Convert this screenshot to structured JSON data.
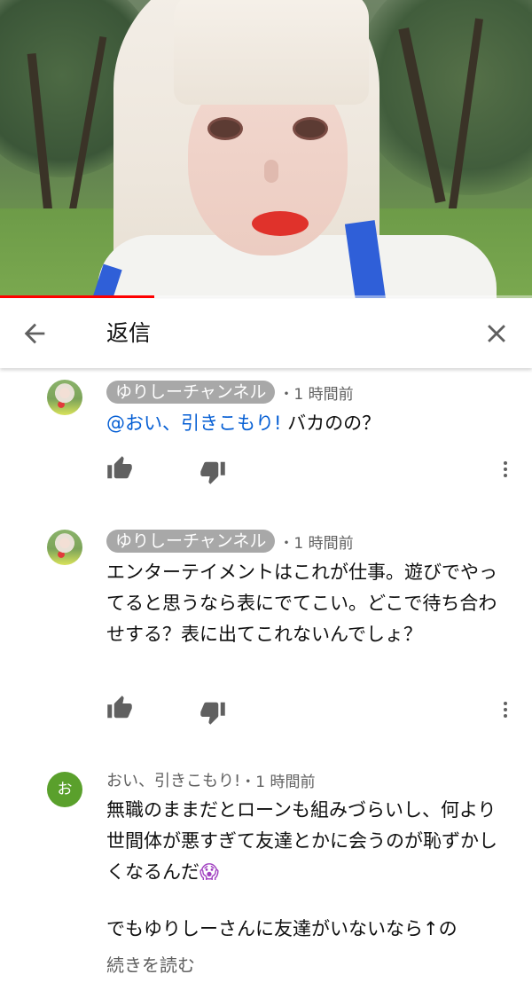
{
  "player": {
    "progress_percent": 29
  },
  "header": {
    "title": "返信"
  },
  "comments": [
    {
      "author": "ゆりしーチャンネル",
      "time": "・1 時間前",
      "mention": "@おい、引きこもり!",
      "text": " バカのの？"
    },
    {
      "author": "ゆりしーチャンネル",
      "time": "・1 時間前",
      "text": "エンターテイメントはこれが仕事。遊びでやってると思うなら表にでてこい。どこで待ち合わせする？表に出てこれないんでしょ？"
    },
    {
      "author": "おい、引きこもり!",
      "time": "・1 時間前",
      "avatar_letter": "お",
      "text_line1": "無職のままだとローンも組みづらいし、何より世間体が悪すぎて友達とかに会うのが恥ずかしくなるんだ",
      "emoji": "😱",
      "text_line2": "でもゆりしーさんに友達がいないなら↑の",
      "read_more": "続きを読む"
    }
  ],
  "icons": {
    "back": "arrow-left-icon",
    "close": "close-icon",
    "like": "thumbs-up-icon",
    "dislike": "thumbs-down-icon",
    "menu": "more-vertical-icon"
  },
  "colors": {
    "accent_red": "#ff0000",
    "mention_blue": "#065fd4",
    "chip_grey": "#a8a8a8",
    "letter_avatar_green": "#5aa02c"
  }
}
